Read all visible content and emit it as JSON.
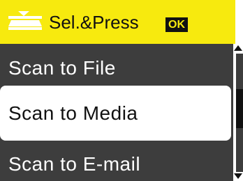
{
  "header": {
    "title": "Sel.&Press",
    "ok_label": "OK",
    "icon": "scanner-icon",
    "background_color": "#f7ea0e"
  },
  "menu": {
    "items": [
      {
        "label": "Scan to File",
        "selected": false
      },
      {
        "label": "Scan to Media",
        "selected": true
      },
      {
        "label": "Scan to E-mail",
        "selected": false
      }
    ],
    "selected_index": 1
  },
  "scrollbar": {
    "position_fraction": 0.45
  },
  "colors": {
    "screen_background": "#3d3d3d",
    "text": "#ffffff",
    "selected_background": "#ffffff",
    "selected_text": "#111111",
    "accent": "#f7ea0e"
  }
}
